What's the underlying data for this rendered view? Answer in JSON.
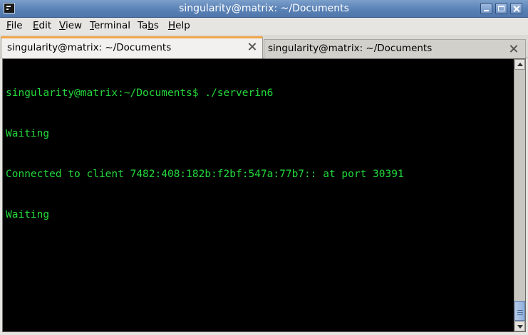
{
  "window": {
    "title": "singularity@matrix: ~/Documents",
    "controls": [
      "minimize",
      "maximize",
      "close"
    ]
  },
  "menubar": {
    "items": [
      {
        "label_u": "F",
        "label_rest": "ile"
      },
      {
        "label_u": "E",
        "label_rest": "dit"
      },
      {
        "label_u": "V",
        "label_rest": "iew"
      },
      {
        "label_u": "T",
        "label_rest": "erminal"
      },
      {
        "label_pre": "Ta",
        "label_u": "b",
        "label_rest": "s"
      },
      {
        "label_u": "H",
        "label_rest": "elp"
      }
    ]
  },
  "tabs": [
    {
      "label": "singularity@matrix: ~/Documents",
      "active": true
    },
    {
      "label": "singularity@matrix: ~/Documents",
      "active": false
    }
  ],
  "terminal": {
    "lines": [
      "singularity@matrix:~/Documents$ ./serverin6",
      "Waiting",
      "Connected to client 7482:408:182b:f2bf:547a:77b7:: at port 30391",
      "Waiting"
    ],
    "text_color": "#23d93b",
    "background": "#000000"
  },
  "scrollbar": {
    "position_fraction": 1.0,
    "visible_fraction": 0.06
  },
  "colors": {
    "titlebar": "#5a82b6",
    "active_tab_accent": "#f0a64a"
  },
  "icons": {
    "app": "terminal-icon",
    "tab_close": "close-icon",
    "cursor": "mouse-pointer-icon"
  }
}
